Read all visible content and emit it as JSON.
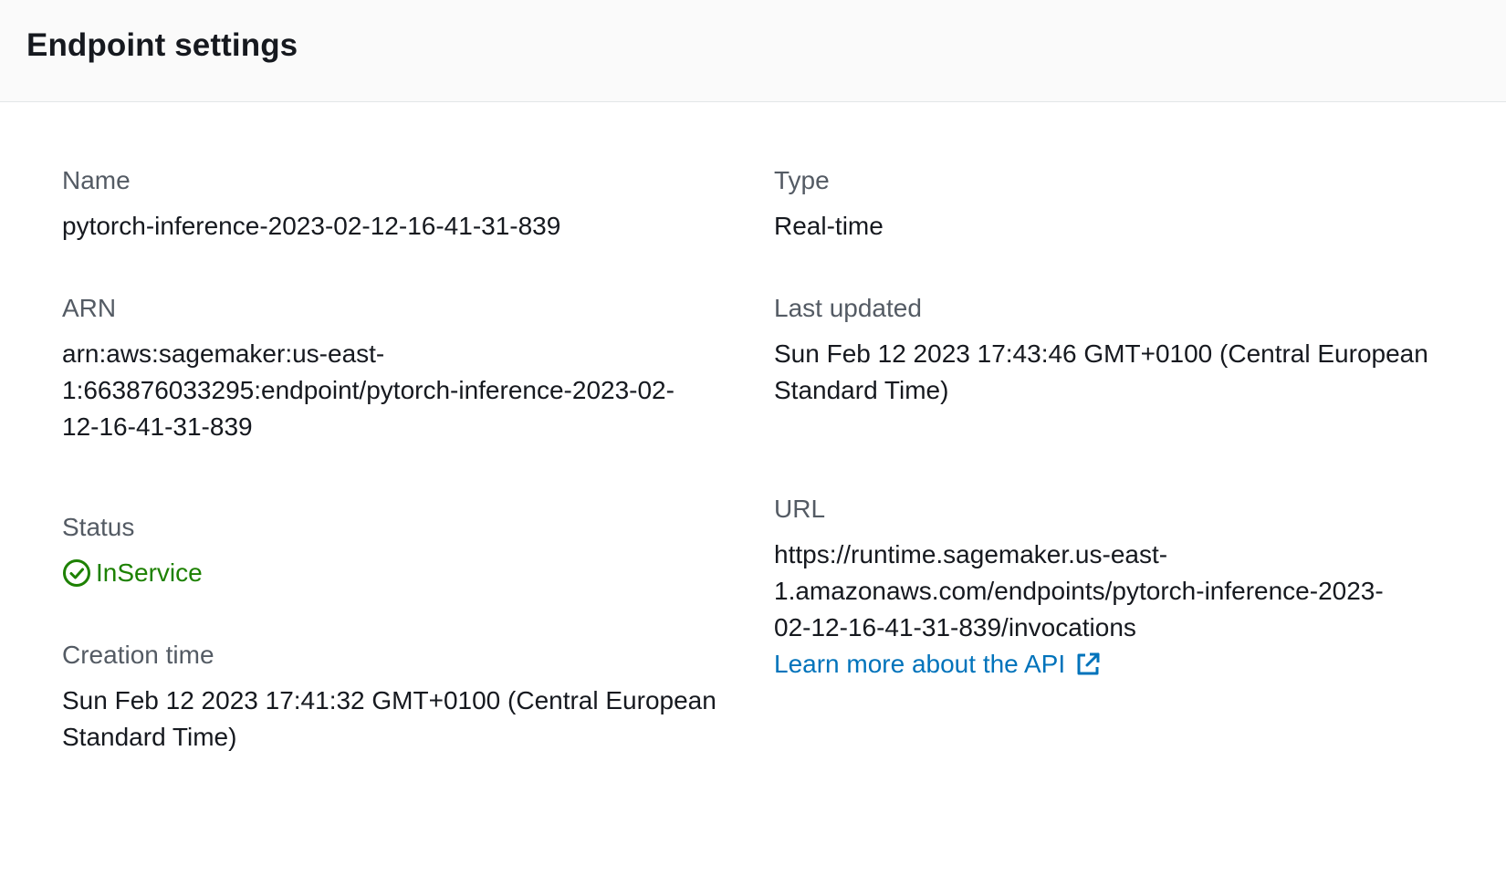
{
  "panel": {
    "title": "Endpoint settings"
  },
  "fields": {
    "name": {
      "label": "Name",
      "value": "pytorch-inference-2023-02-12-16-41-31-839"
    },
    "type": {
      "label": "Type",
      "value": "Real-time"
    },
    "arn": {
      "label": "ARN",
      "line1": "arn:aws:sagemaker:us-east-",
      "line2": "1:663876033295:endpoint/pytorch-inference-2023-02-",
      "line3": "12-16-41-31-839"
    },
    "last_updated": {
      "label": "Last updated",
      "line1": "Sun Feb 12 2023 17:43:46 GMT+0100 (Central European",
      "line2": "Standard Time)"
    },
    "url": {
      "label": "URL",
      "line1": "https://runtime.sagemaker.us-east-",
      "line2": "1.amazonaws.com/endpoints/pytorch-inference-2023-",
      "line3": "02-12-16-41-31-839/invocations",
      "link_text": "Learn more about the API"
    },
    "status": {
      "label": "Status",
      "value": "InService"
    },
    "creation_time": {
      "label": "Creation time",
      "line1": "Sun Feb 12 2023 17:41:32 GMT+0100 (Central European",
      "line2": "Standard Time)"
    }
  },
  "colors": {
    "success": "#1d8102",
    "link": "#0073bb",
    "label": "#545b64",
    "text": "#16191f"
  },
  "icons": {
    "status": "status-positive-icon",
    "external": "external-link-icon"
  }
}
